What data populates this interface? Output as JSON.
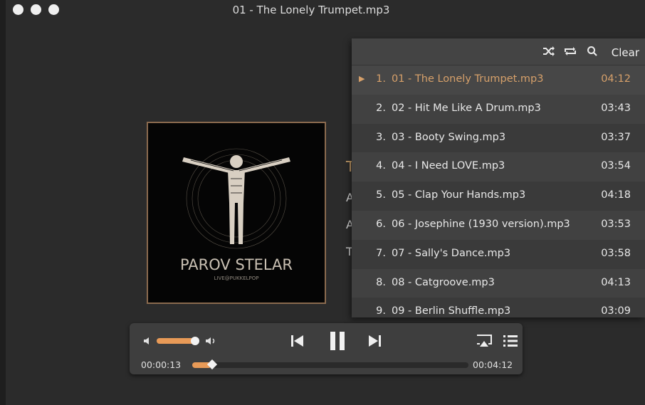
{
  "window": {
    "title": "01 - The Lonely Trumpet.mp3"
  },
  "album": {
    "artist_text": "PAROV STELAR",
    "subtitle_text": "LIVE@PUKKELPOP"
  },
  "track_meta": {
    "line1": "T",
    "line2": "A",
    "line3": "A",
    "line4": "T"
  },
  "playlist": {
    "toolbar": {
      "shuffle_icon": "shuffle-icon",
      "repeat_icon": "repeat-icon",
      "search_icon": "search-icon",
      "clear_label": "Clear"
    },
    "current_index": 0,
    "items": [
      {
        "num": "1.",
        "name": "01 - The Lonely Trumpet.mp3",
        "duration": "04:12"
      },
      {
        "num": "2.",
        "name": "02 - Hit Me Like A Drum.mp3",
        "duration": "03:43"
      },
      {
        "num": "3.",
        "name": "03 - Booty Swing.mp3",
        "duration": "03:37"
      },
      {
        "num": "4.",
        "name": "04 - I Need LOVE.mp3",
        "duration": "03:54"
      },
      {
        "num": "5.",
        "name": "05 - Clap Your Hands.mp3",
        "duration": "04:18"
      },
      {
        "num": "6.",
        "name": "06 - Josephine (1930 version).mp3",
        "duration": "03:53"
      },
      {
        "num": "7.",
        "name": "07 - Sally's Dance.mp3",
        "duration": "03:58"
      },
      {
        "num": "8.",
        "name": "08 - Catgroove.mp3",
        "duration": "04:13"
      },
      {
        "num": "9.",
        "name": "09 - Berlin Shuffle.mp3",
        "duration": "03:09"
      }
    ]
  },
  "player": {
    "elapsed": "00:00:13",
    "total": "00:04:12",
    "progress_fraction": 0.05,
    "volume_fraction": 0.9,
    "accent_color": "#e89a57",
    "icons": {
      "volume_min": "volume-low-icon",
      "volume_max": "volume-high-icon",
      "previous": "previous-track-icon",
      "pause": "pause-icon",
      "next": "next-track-icon",
      "airplay": "airplay-icon",
      "playlist": "playlist-icon"
    }
  }
}
